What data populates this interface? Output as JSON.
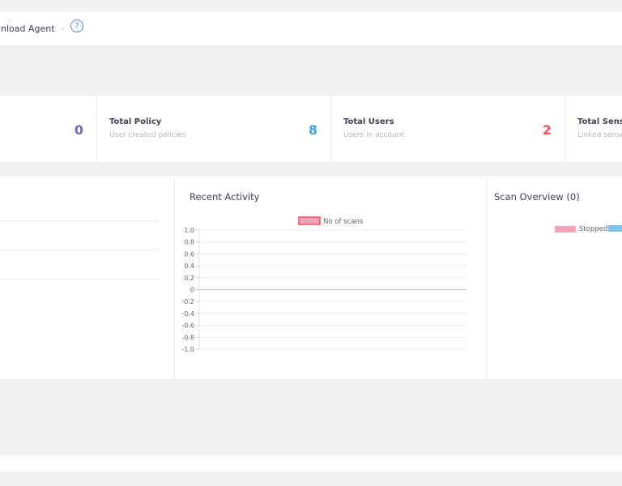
{
  "topbar": {
    "download_agent_label": "wnload Agent",
    "chevron_glyph": "⌄",
    "help_glyph": "?"
  },
  "stats": [
    {
      "title": "",
      "subtitle": "",
      "value": "0",
      "color": "#6e6bc9"
    },
    {
      "title": "Total Policy",
      "subtitle": "User created policies",
      "value": "8",
      "color": "#3da5e0"
    },
    {
      "title": "Total Users",
      "subtitle": "Users in account",
      "value": "2",
      "color": "#f64e60"
    },
    {
      "title": "Total Senso",
      "subtitle": "Linked sensor",
      "value": "",
      "color": "#3f4254"
    }
  ],
  "recent_activity": {
    "title": "Recent Activity"
  },
  "scan_overview": {
    "title": "Scan Overview (0)",
    "legend": [
      {
        "name": "Stopped",
        "color": "#f7a3b8"
      },
      {
        "name": "",
        "color": "#7fc4ec"
      }
    ]
  },
  "chart_data": {
    "type": "line",
    "legend": [
      {
        "name": "No of scans",
        "color": "#f64e60"
      }
    ],
    "series": [
      {
        "name": "No of scans",
        "values": []
      }
    ],
    "yticks": [
      "1.0",
      "0.8",
      "0.6",
      "0.4",
      "0.2",
      "0",
      "-0.2",
      "-0.4",
      "-0.6",
      "-0.8",
      "-1.0"
    ],
    "ylim": [
      -1.0,
      1.0
    ],
    "grid": true
  }
}
